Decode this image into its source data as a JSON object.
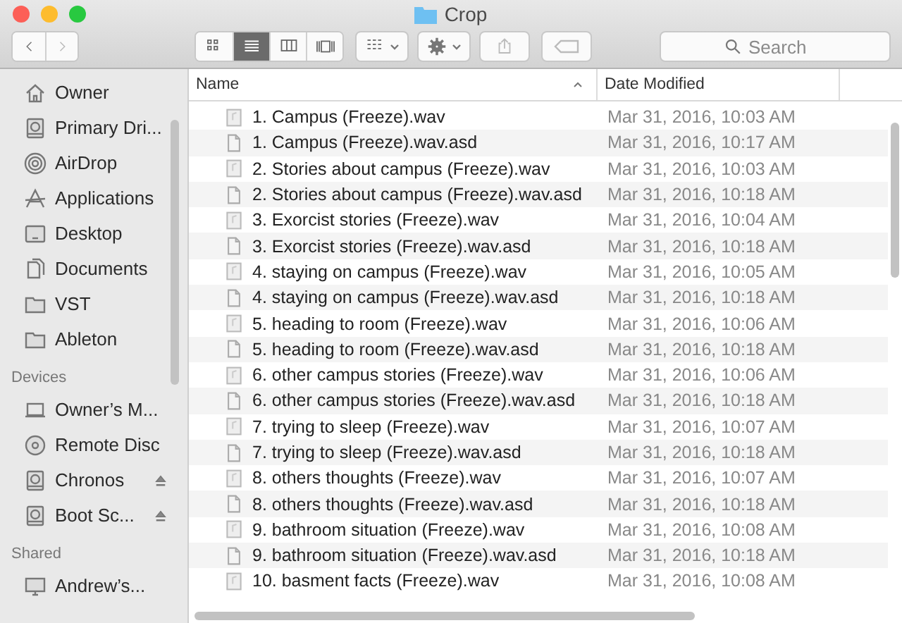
{
  "window": {
    "title": "Crop"
  },
  "toolbar": {
    "views": [
      {
        "kind": "icons",
        "selected": false
      },
      {
        "kind": "list",
        "selected": true
      },
      {
        "kind": "columns",
        "selected": false
      },
      {
        "kind": "coverflow",
        "selected": false
      }
    ],
    "search": {
      "placeholder": "Search"
    }
  },
  "sidebar": {
    "favorites": [
      {
        "label": "Owner",
        "kind": "home"
      },
      {
        "label": "Primary Dri...",
        "kind": "drive"
      },
      {
        "label": "AirDrop",
        "kind": "airdrop"
      },
      {
        "label": "Applications",
        "kind": "apps"
      },
      {
        "label": "Desktop",
        "kind": "desktop"
      },
      {
        "label": "Documents",
        "kind": "documents"
      },
      {
        "label": "VST",
        "kind": "folder"
      },
      {
        "label": "Ableton",
        "kind": "folder"
      }
    ],
    "sections": [
      {
        "title": "Devices",
        "items": [
          {
            "label": "Owner’s M...",
            "kind": "laptop",
            "ejectable": false
          },
          {
            "label": "Remote Disc",
            "kind": "disc",
            "ejectable": false
          },
          {
            "label": "Chronos",
            "kind": "drive",
            "ejectable": true
          },
          {
            "label": "Boot Sc...",
            "kind": "drive",
            "ejectable": true
          }
        ]
      },
      {
        "title": "Shared",
        "items": [
          {
            "label": "Andrew’s...",
            "kind": "monitor",
            "ejectable": false
          }
        ]
      }
    ]
  },
  "table": {
    "columns": [
      {
        "label": "Name",
        "sorted": true
      },
      {
        "label": "Date Modified",
        "sorted": false
      }
    ],
    "rows": [
      {
        "name": "1. Campus (Freeze).wav",
        "date": "Mar 31, 2016, 10:03 AM",
        "kind": "audio"
      },
      {
        "name": "1. Campus (Freeze).wav.asd",
        "date": "Mar 31, 2016, 10:17 AM",
        "kind": "document"
      },
      {
        "name": "2. Stories about campus (Freeze).wav",
        "date": "Mar 31, 2016, 10:03 AM",
        "kind": "audio"
      },
      {
        "name": "2. Stories about campus (Freeze).wav.asd",
        "date": "Mar 31, 2016, 10:18 AM",
        "kind": "document"
      },
      {
        "name": "3. Exorcist stories (Freeze).wav",
        "date": "Mar 31, 2016, 10:04 AM",
        "kind": "audio"
      },
      {
        "name": "3. Exorcist stories (Freeze).wav.asd",
        "date": "Mar 31, 2016, 10:18 AM",
        "kind": "document"
      },
      {
        "name": "4. staying on campus (Freeze).wav",
        "date": "Mar 31, 2016, 10:05 AM",
        "kind": "audio"
      },
      {
        "name": "4. staying on campus (Freeze).wav.asd",
        "date": "Mar 31, 2016, 10:18 AM",
        "kind": "document"
      },
      {
        "name": "5. heading to room (Freeze).wav",
        "date": "Mar 31, 2016, 10:06 AM",
        "kind": "audio"
      },
      {
        "name": "5. heading to room (Freeze).wav.asd",
        "date": "Mar 31, 2016, 10:18 AM",
        "kind": "document"
      },
      {
        "name": "6. other campus stories (Freeze).wav",
        "date": "Mar 31, 2016, 10:06 AM",
        "kind": "audio"
      },
      {
        "name": "6. other campus stories (Freeze).wav.asd",
        "date": "Mar 31, 2016, 10:18 AM",
        "kind": "document"
      },
      {
        "name": "7. trying to sleep (Freeze).wav",
        "date": "Mar 31, 2016, 10:07 AM",
        "kind": "audio"
      },
      {
        "name": "7. trying to sleep (Freeze).wav.asd",
        "date": "Mar 31, 2016, 10:18 AM",
        "kind": "document"
      },
      {
        "name": "8. others thoughts (Freeze).wav",
        "date": "Mar 31, 2016, 10:07 AM",
        "kind": "audio"
      },
      {
        "name": "8. others thoughts (Freeze).wav.asd",
        "date": "Mar 31, 2016, 10:18 AM",
        "kind": "document"
      },
      {
        "name": "9. bathroom situation (Freeze).wav",
        "date": "Mar 31, 2016, 10:08 AM",
        "kind": "audio"
      },
      {
        "name": "9. bathroom situation (Freeze).wav.asd",
        "date": "Mar 31, 2016, 10:18 AM",
        "kind": "document"
      },
      {
        "name": "10. basment facts (Freeze).wav",
        "date": "Mar 31, 2016, 10:08 AM",
        "kind": "audio"
      }
    ]
  }
}
